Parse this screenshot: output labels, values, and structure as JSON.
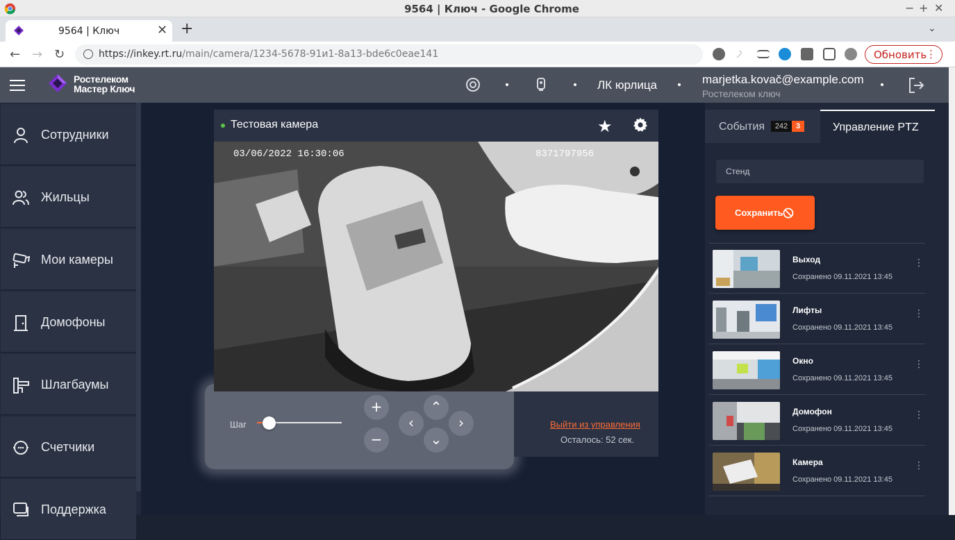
{
  "window": {
    "title": "9564 | Ключ - Google Chrome",
    "minimize": "−",
    "maximize": "+",
    "close": "✕"
  },
  "tab": {
    "label": "9564 | Ключ",
    "close": "✕",
    "new_tab": "+",
    "menu": "⌄"
  },
  "address": {
    "url_host": "https://inkey.rt.ru",
    "url_path": "/main/camera/1234-5678-91и1-8a13-bde6c0eae141",
    "update_label": "Обновить",
    "update_menu": "⋮",
    "back": "←",
    "forward": "→",
    "reload": "↻"
  },
  "header": {
    "brand_line1": "Ростелеком",
    "brand_line2": "Мастер Ключ",
    "account_type": "ЛК юрлица",
    "email": "marjetka.kovač@example.com",
    "organization": "Ростелеком ключ"
  },
  "sidebar": {
    "items": [
      {
        "label": "Сотрудники",
        "icon": "person-icon"
      },
      {
        "label": "Жильцы",
        "icon": "people-icon"
      },
      {
        "label": "Мои камеры",
        "icon": "camera-icon"
      },
      {
        "label": "Домофоны",
        "icon": "door-icon"
      },
      {
        "label": "Шлагбаумы",
        "icon": "barrier-icon"
      },
      {
        "label": "Счетчики",
        "icon": "meter-icon"
      },
      {
        "label": "Поддержка",
        "icon": "support-icon"
      }
    ]
  },
  "camera": {
    "name": "Тестовая камера",
    "timestamp": "03/06/2022 16:30:06",
    "serial": "8371797956",
    "status_color": "#5ac24a"
  },
  "ptz": {
    "step_label": "Шаг",
    "step_value": 0.15,
    "zoom_in": "+",
    "zoom_out": "−",
    "up": "⌃",
    "down": "⌄",
    "left": "‹",
    "right": "›",
    "exit_link": "Выйти из управления",
    "remaining": "Осталось: 52 сек."
  },
  "right_panel": {
    "tab_events": "События",
    "events_count": "242",
    "events_new": "3",
    "tab_ptz": "Управление PTZ",
    "preset_input_value": "Стенд",
    "save_label": "Сохранить",
    "presets": [
      {
        "name": "Выход",
        "saved": "Сохранено 09.11.2021 13:45",
        "more": "⋮"
      },
      {
        "name": "Лифты",
        "saved": "Сохранено 09.11.2021 13:45",
        "more": "⋮"
      },
      {
        "name": "Окно",
        "saved": "Сохранено 09.11.2021 13:45",
        "more": "⋮"
      },
      {
        "name": "Домофон",
        "saved": "Сохранено 09.11.2021 13:45",
        "more": "⋮"
      },
      {
        "name": "Камера",
        "saved": "Сохранено 09.11.2021 13:45",
        "more": "⋮"
      }
    ]
  },
  "colors": {
    "accent": "#ff5a1f",
    "header_bg": "#4a505c",
    "panel_bg": "#2a3244"
  }
}
